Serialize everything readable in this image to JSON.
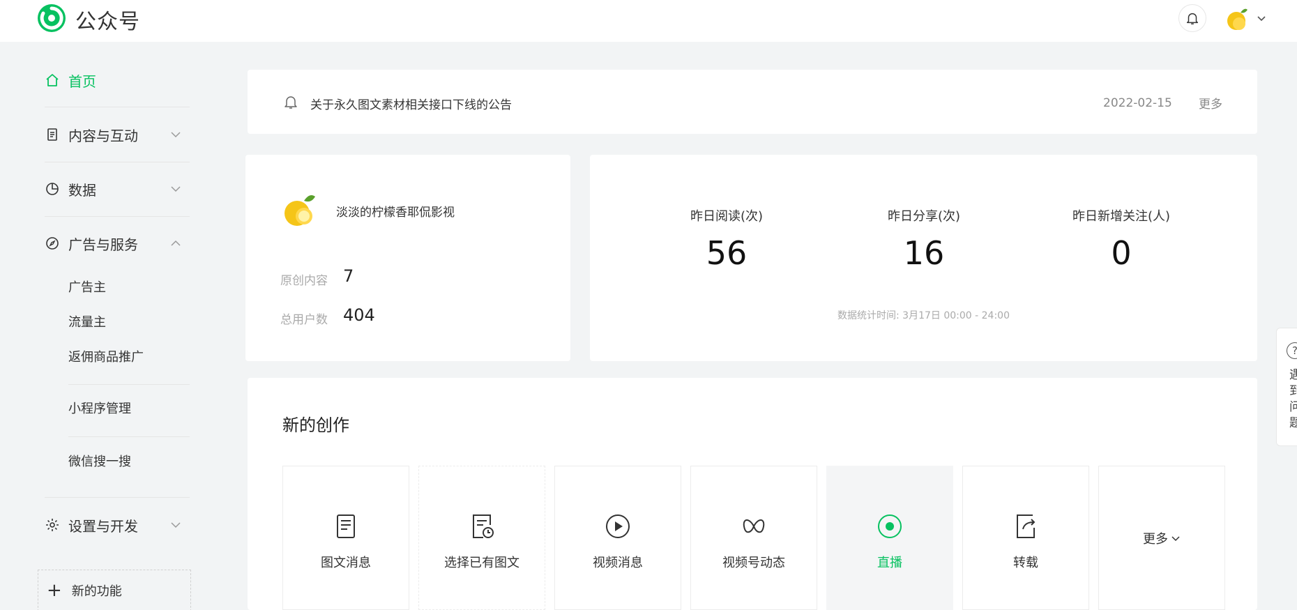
{
  "header": {
    "brand": "公众号",
    "icons": [
      "wechat-logo",
      "bell-icon",
      "lemon-avatar",
      "chevron-down-icon"
    ]
  },
  "sidebar": {
    "items": [
      {
        "label": "首页",
        "icon": "home-icon",
        "active": true
      },
      {
        "label": "内容与互动",
        "icon": "document-icon"
      },
      {
        "label": "数据",
        "icon": "pie-chart-icon"
      },
      {
        "label": "广告与服务",
        "icon": "compass-icon",
        "expanded": true
      },
      {
        "label": "设置与开发",
        "icon": "gear-icon"
      }
    ],
    "sub_items": [
      "广告主",
      "流量主",
      "返佣商品推广",
      "小程序管理",
      "微信搜一搜"
    ],
    "new_feature": "新的功能"
  },
  "notice": {
    "text": "关于永久图文素材相关接口下线的公告",
    "date": "2022-02-15",
    "more": "更多"
  },
  "account": {
    "name": "淡淡的柠檬香耶侃影视",
    "original_label": "原创内容",
    "original_value": "7",
    "users_label": "总用户数",
    "users_value": "404"
  },
  "stats": {
    "items": [
      {
        "label": "昨日阅读(次)",
        "value": "56"
      },
      {
        "label": "昨日分享(次)",
        "value": "16"
      },
      {
        "label": "昨日新增关注(人)",
        "value": "0"
      }
    ],
    "time": "数据统计时间: 3月17日 00:00 - 24:00"
  },
  "create": {
    "title": "新的创作",
    "tiles": [
      {
        "label": "图文消息",
        "icon": "article-icon"
      },
      {
        "label": "选择已有图文",
        "icon": "article-clock-icon"
      },
      {
        "label": "视频消息",
        "icon": "play-circle-icon"
      },
      {
        "label": "视频号动态",
        "icon": "butterfly-icon"
      },
      {
        "label": "直播",
        "icon": "live-icon",
        "highlight": true
      },
      {
        "label": "转载",
        "icon": "share-doc-icon"
      }
    ],
    "more": "更多"
  },
  "help": {
    "text": "遇到问题"
  },
  "colors": {
    "accent": "#07c160",
    "background": "#f2f4f5"
  }
}
